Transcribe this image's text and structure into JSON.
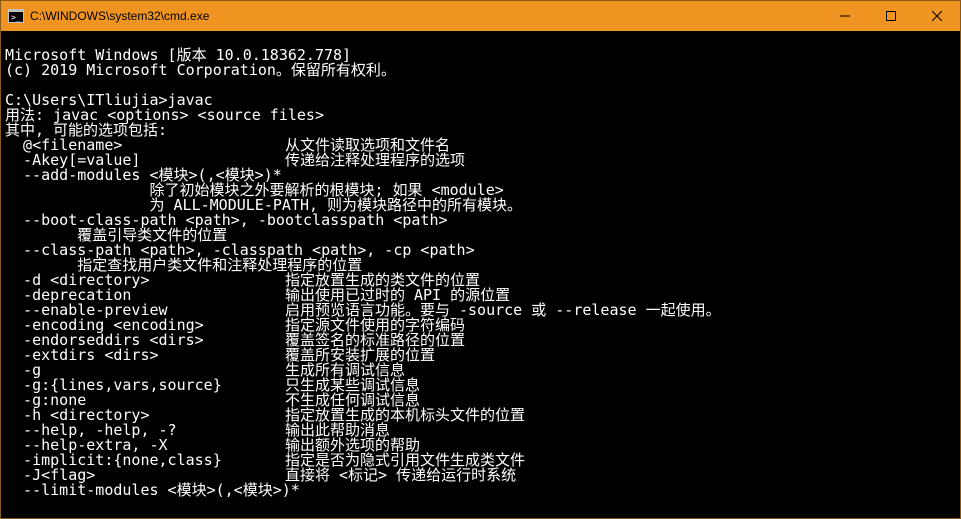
{
  "window": {
    "title": "C:\\WINDOWS\\system32\\cmd.exe"
  },
  "term": {
    "line1": "Microsoft Windows [版本 10.0.18362.778]",
    "line2": "(c) 2019 Microsoft Corporation。保留所有权利。",
    "blank1": "",
    "prompt": "C:\\Users\\ITliujia>javac",
    "usage": "用法: javac <options> <source files>",
    "where": "其中, 可能的选项包括:",
    "opt_atfile": "  @<filename>                  从文件读取选项和文件名",
    "opt_akey": "  -Akey[=value]                传递给注释处理程序的选项",
    "opt_addmod1": "  --add-modules <模块>(,<模块>)*",
    "opt_addmod2": "                除了初始模块之外要解析的根模块; 如果 <module>",
    "opt_addmod3": "                为 ALL-MODULE-PATH, 则为模块路径中的所有模块。",
    "opt_bootcp1": "  --boot-class-path <path>, -bootclasspath <path>",
    "opt_bootcp2": "        覆盖引导类文件的位置",
    "opt_cp1": "  --class-path <path>, -classpath <path>, -cp <path>",
    "opt_cp2": "        指定查找用户类文件和注释处理程序的位置",
    "opt_d": "  -d <directory>               指定放置生成的类文件的位置",
    "opt_deprec": "  -deprecation                 输出使用已过时的 API 的源位置",
    "opt_preview": "  --enable-preview             启用预览语言功能。要与 -source 或 --release 一起使用。",
    "opt_encoding": "  -encoding <encoding>         指定源文件使用的字符编码",
    "opt_endorsed": "  -endorseddirs <dirs>         覆盖签名的标准路径的位置",
    "opt_extdirs": "  -extdirs <dirs>              覆盖所安装扩展的位置",
    "opt_g": "  -g                           生成所有调试信息",
    "opt_glines": "  -g:{lines,vars,source}       只生成某些调试信息",
    "opt_gnone": "  -g:none                      不生成任何调试信息",
    "opt_h": "  -h <directory>               指定放置生成的本机标头文件的位置",
    "opt_help": "  --help, -help, -?            输出此帮助消息",
    "opt_helpex": "  --help-extra, -X             输出额外选项的帮助",
    "opt_implicit": "  -implicit:{none,class}       指定是否为隐式引用文件生成类文件",
    "opt_jflag": "  -J<flag>                     直接将 <标记> 传递给运行时系统",
    "opt_limit": "  --limit-modules <模块>(,<模块>)*"
  }
}
